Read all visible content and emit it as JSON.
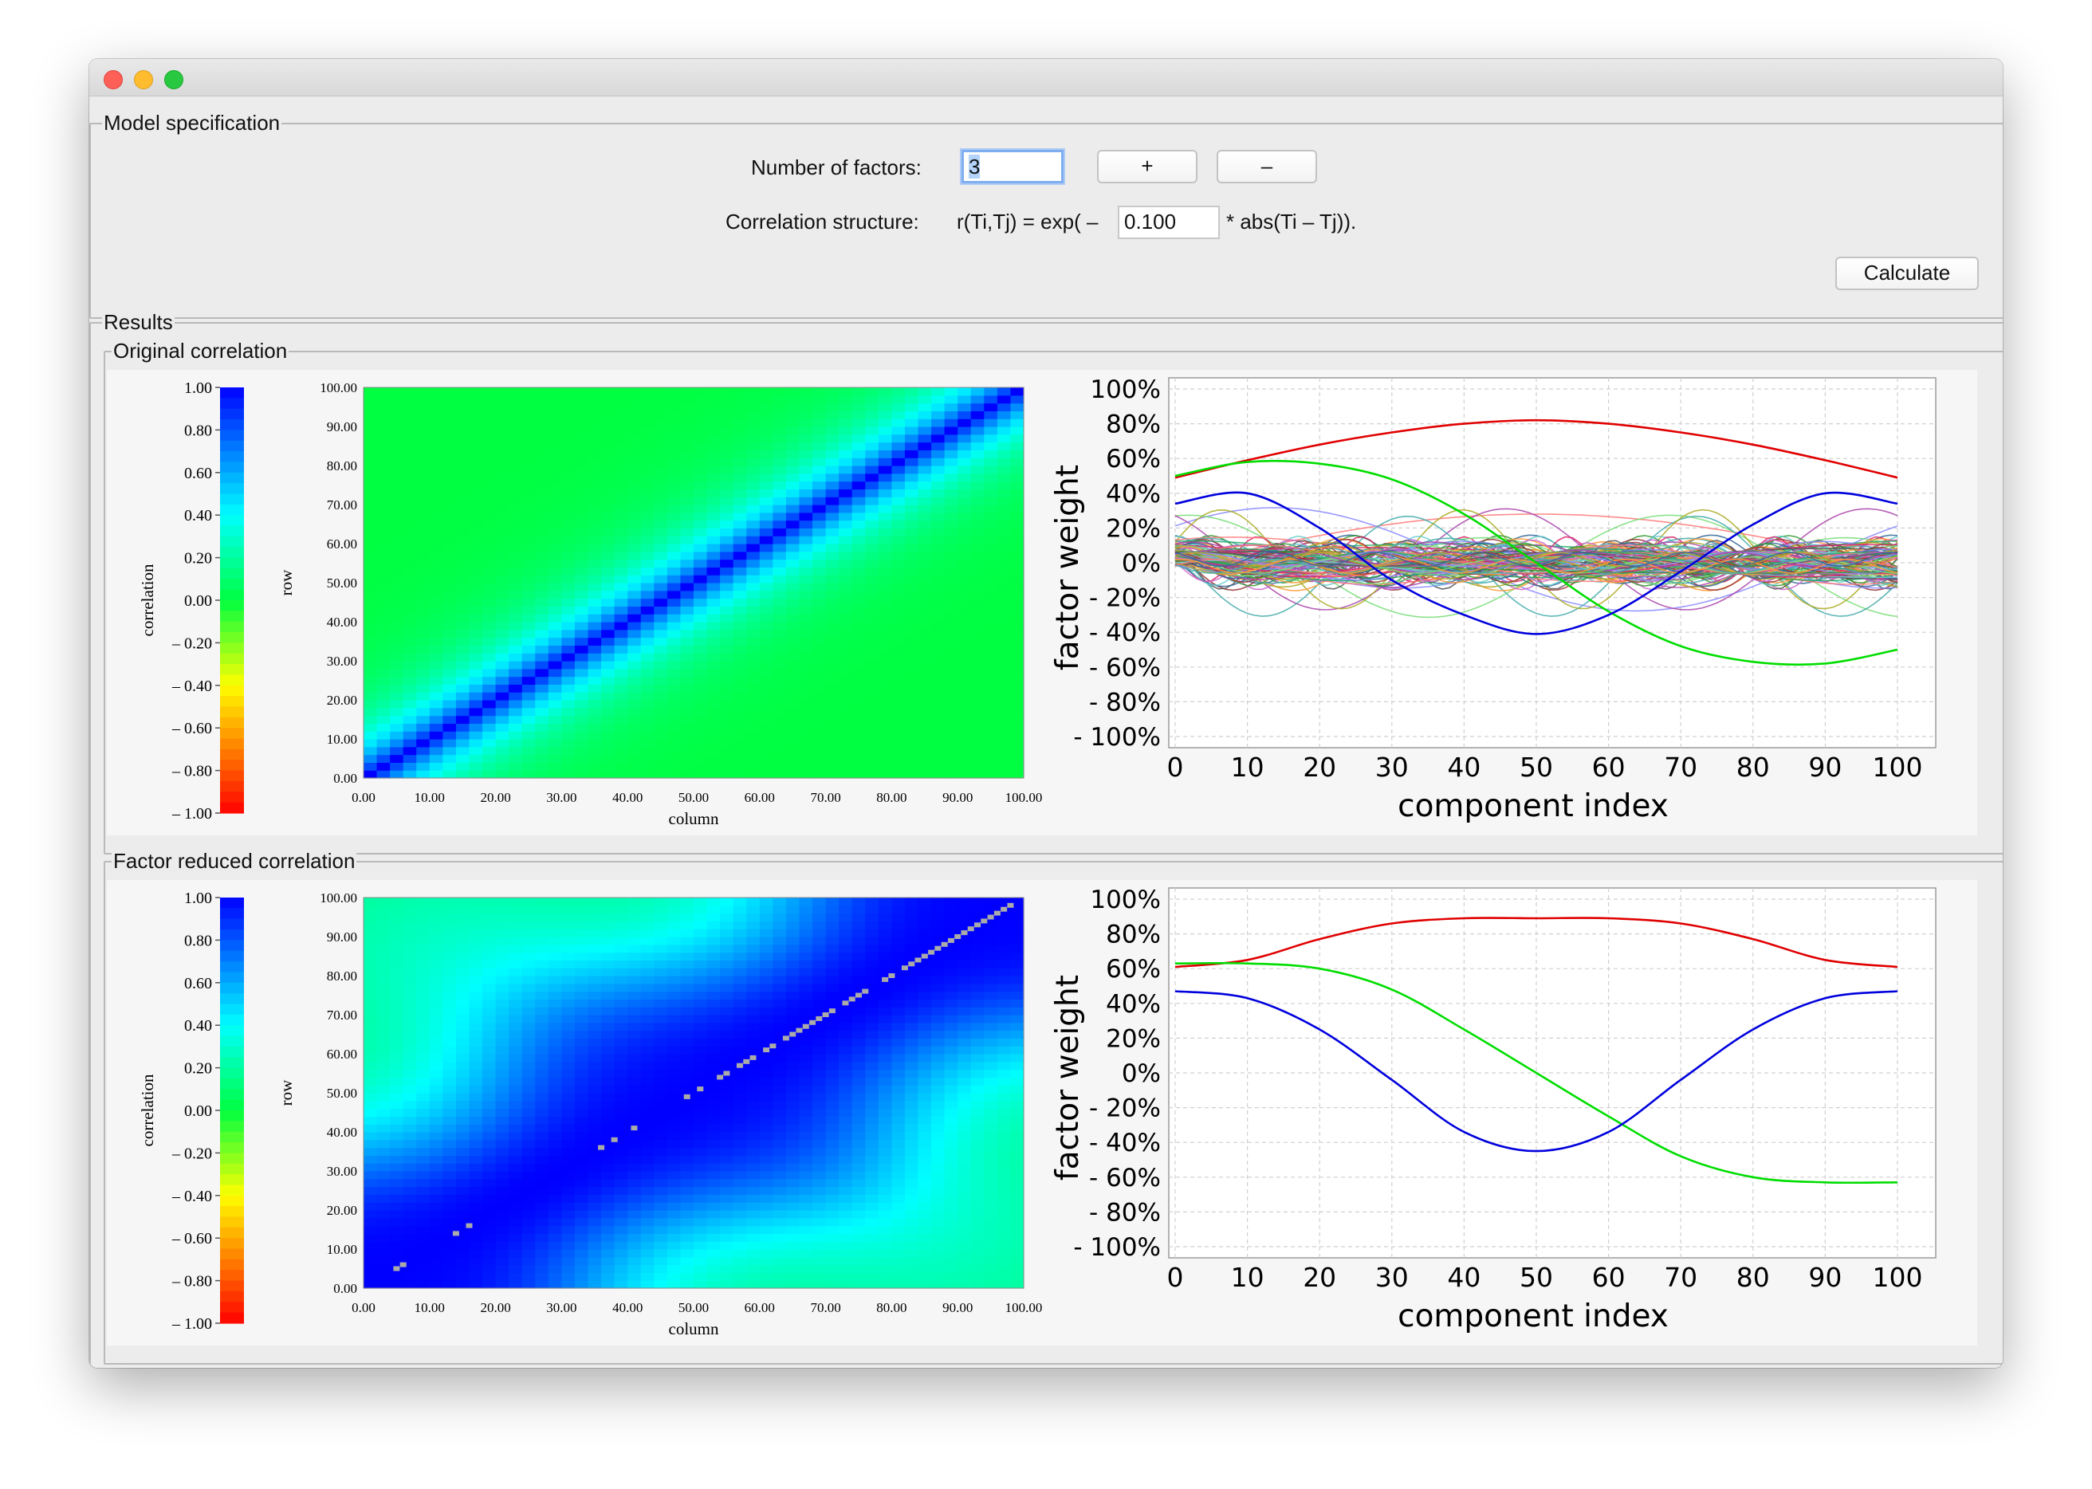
{
  "window": {
    "title": ""
  },
  "model": {
    "legend": "Model specification",
    "factors_label": "Number of factors:",
    "factors_value": "3",
    "plus_label": "+",
    "minus_label": "–",
    "corr_label": "Correlation structure:",
    "corr_prefix": "r(Ti,Tj) = exp( –",
    "corr_value": "0.100",
    "corr_suffix": "* abs(Ti – Tj)).",
    "calculate_label": "Calculate"
  },
  "results": {
    "legend": "Results",
    "original_legend": "Original correlation",
    "reduced_legend": "Factor reduced correlation"
  },
  "colors": {
    "window_bg": "#ececec",
    "focus": "#7eaef0"
  },
  "chart_data": [
    {
      "type": "heatmap",
      "title": "",
      "xlabel": "column",
      "ylabel": "row",
      "colorbar_label": "correlation",
      "colorbar_ticks": [
        "1.00",
        "0.80",
        "0.60",
        "0.40",
        "0.20",
        "0.00",
        "– 0.20",
        "– 0.40",
        "– 0.60",
        "– 0.80",
        "– 1.00"
      ],
      "xticks": [
        "0.00",
        "10.00",
        "20.00",
        "30.00",
        "40.00",
        "50.00",
        "60.00",
        "70.00",
        "80.00",
        "90.00",
        "100.00"
      ],
      "yticks": [
        "100.00",
        "90.00",
        "80.00",
        "70.00",
        "60.00",
        "50.00",
        "40.00",
        "30.00",
        "20.00",
        "10.00",
        "0.00"
      ],
      "xlim": [
        0,
        100
      ],
      "ylim": [
        0,
        100
      ],
      "clim": [
        -1,
        1
      ],
      "formula": "exp(-0.1*abs(i-j))"
    },
    {
      "type": "line",
      "title": "",
      "xlabel": "component index",
      "ylabel": "factor weight",
      "xticks": [
        "0",
        "10",
        "20",
        "30",
        "40",
        "50",
        "60",
        "70",
        "80",
        "90",
        "100"
      ],
      "yticks": [
        "100%",
        "80%",
        "60%",
        "40%",
        "20%",
        "0%",
        "- 20%",
        "- 40%",
        "- 60%",
        "- 80%",
        "- 100%"
      ],
      "xlim": [
        0,
        100
      ],
      "ylim": [
        -100,
        100
      ],
      "grid": true,
      "series": [
        {
          "color": "#e00000",
          "x": [
            0,
            10,
            20,
            30,
            40,
            50,
            60,
            70,
            80,
            90,
            100
          ],
          "values": [
            49,
            59,
            68,
            75,
            80,
            82,
            80,
            75,
            68,
            59,
            49
          ]
        },
        {
          "color": "#00dd00",
          "x": [
            0,
            10,
            20,
            30,
            40,
            50,
            60,
            70,
            80,
            90,
            100
          ],
          "values": [
            50,
            58,
            57,
            48,
            28,
            0,
            -28,
            -48,
            -57,
            -58,
            -50
          ]
        },
        {
          "color": "#0000dd",
          "x": [
            0,
            10,
            20,
            30,
            40,
            50,
            60,
            70,
            80,
            90,
            100
          ],
          "values": [
            34,
            40,
            20,
            -10,
            -30,
            -41,
            -30,
            -5,
            22,
            40,
            34
          ]
        }
      ],
      "other_series_count": 98,
      "other_series_range": [
        -30,
        30
      ]
    },
    {
      "type": "heatmap",
      "title": "",
      "xlabel": "column",
      "ylabel": "row",
      "colorbar_label": "correlation",
      "colorbar_ticks": [
        "1.00",
        "0.80",
        "0.60",
        "0.40",
        "0.20",
        "0.00",
        "– 0.20",
        "– 0.40",
        "– 0.60",
        "– 0.80",
        "– 1.00"
      ],
      "xticks": [
        "0.00",
        "10.00",
        "20.00",
        "30.00",
        "40.00",
        "50.00",
        "60.00",
        "70.00",
        "80.00",
        "90.00",
        "100.00"
      ],
      "yticks": [
        "100.00",
        "90.00",
        "80.00",
        "70.00",
        "60.00",
        "50.00",
        "40.00",
        "30.00",
        "20.00",
        "10.00",
        "0.00"
      ],
      "xlim": [
        0,
        100
      ],
      "ylim": [
        0,
        100
      ],
      "clim": [
        -1,
        1
      ],
      "formula": "3-factor reduction of exp(-0.1*abs(i-j))"
    },
    {
      "type": "line",
      "title": "",
      "xlabel": "component index",
      "ylabel": "factor weight",
      "xticks": [
        "0",
        "10",
        "20",
        "30",
        "40",
        "50",
        "60",
        "70",
        "80",
        "90",
        "100"
      ],
      "yticks": [
        "100%",
        "80%",
        "60%",
        "40%",
        "20%",
        "0%",
        "- 20%",
        "- 40%",
        "- 60%",
        "- 80%",
        "- 100%"
      ],
      "xlim": [
        0,
        100
      ],
      "ylim": [
        -100,
        100
      ],
      "grid": true,
      "series": [
        {
          "color": "#e00000",
          "x": [
            0,
            10,
            20,
            30,
            40,
            50,
            60,
            70,
            80,
            90,
            100
          ],
          "values": [
            61,
            65,
            77,
            86,
            89,
            89,
            89,
            86,
            77,
            65,
            61
          ]
        },
        {
          "color": "#00dd00",
          "x": [
            0,
            10,
            20,
            30,
            40,
            50,
            60,
            70,
            80,
            90,
            100
          ],
          "values": [
            63,
            63,
            60,
            48,
            25,
            0,
            -25,
            -48,
            -60,
            -63,
            -63
          ]
        },
        {
          "color": "#0000dd",
          "x": [
            0,
            10,
            20,
            30,
            40,
            50,
            60,
            70,
            80,
            90,
            100
          ],
          "values": [
            47,
            43,
            25,
            -4,
            -34,
            -45,
            -34,
            -4,
            25,
            43,
            47
          ]
        }
      ]
    }
  ]
}
